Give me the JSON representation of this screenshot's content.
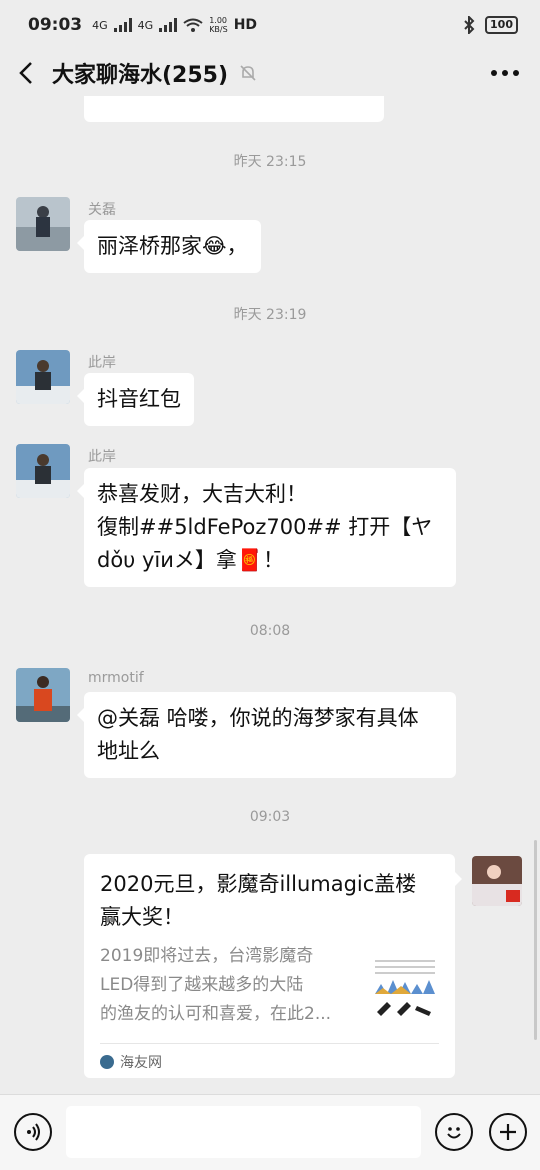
{
  "status": {
    "time": "09:03",
    "signal1": "4G",
    "signal2": "4G",
    "speed": "1.00\nKB/S",
    "hd": "HD",
    "battery": "100"
  },
  "header": {
    "title": "大家聊海水(255)",
    "icons": {
      "back": "chevron-left-icon",
      "mute": "bell-off-icon",
      "more": "more-dots-icon"
    }
  },
  "messages": {
    "t1": "昨天 23:15",
    "m1": {
      "sender": "关磊",
      "text": "丽泽桥那家😂，"
    },
    "t2": "昨天 23:19",
    "m2": {
      "sender": "此岸",
      "text": "抖音红包"
    },
    "m3": {
      "sender": "此岸",
      "line1": "恭喜发财，大吉大利！",
      "line2": "復制##5ldFePoz700## 打开【ヤ",
      "line3": "dǒυ yīиメ】拿🧧！"
    },
    "t3": "08:08",
    "m4": {
      "sender": "mrmotif",
      "line1": "@关磊  哈喽，你说的海梦家有具体",
      "line2": "地址么"
    },
    "t4": "09:03",
    "card": {
      "title_line1": "2020元旦，影魔奇illumagic盖楼",
      "title_line2": "赢大奖！",
      "desc1": "2019即将过去，台湾影魔奇",
      "desc2": "LED得到了越来越多的大陆",
      "desc3": "的渔友的认可和喜爱，在此2...",
      "source": "海友网"
    }
  },
  "input": {
    "placeholder": ""
  },
  "colors": {
    "bg": "#ededed",
    "bubble": "#ffffff",
    "timestamp": "#9a9a9a"
  }
}
